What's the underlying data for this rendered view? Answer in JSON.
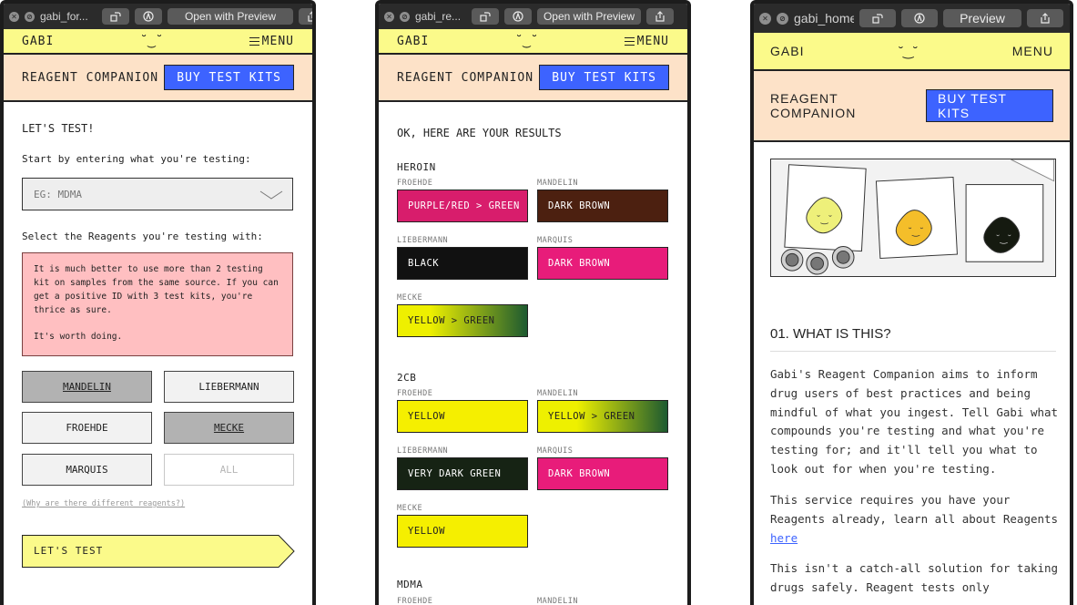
{
  "colors": {
    "yellow": "#fbfa8a",
    "peach": "#fde2c8",
    "blue": "#3d63ff",
    "pink": "#ffbfc1"
  },
  "windows": [
    {
      "title": "gabi_for...",
      "open_label": "Open with Preview"
    },
    {
      "title": "gabi_re...",
      "open_label": "Open with Preview"
    },
    {
      "title": "gabi_home",
      "open_label": "Preview"
    }
  ],
  "header": {
    "logo": "GABI",
    "smiley": "˘‿˘",
    "menu": "MENU",
    "menu_alt": "MENU"
  },
  "subheader": {
    "title": "REAGENT COMPANION",
    "buy": "BUY TEST KITS"
  },
  "form": {
    "heading": "LET'S TEST!",
    "prompt": "Start by entering what you're testing:",
    "select_placeholder": "EG: MDMA",
    "reagents_prompt": "Select the Reagents you're testing with:",
    "warning": [
      "It is much better to use more than 2 testing kit on samples from the same source. If you can get a positive ID with 3 test kits, you're thrice as sure.",
      "It's worth doing."
    ],
    "reagents": [
      {
        "label": "MANDELIN",
        "state": "selected"
      },
      {
        "label": "LIEBERMANN",
        "state": "default"
      },
      {
        "label": "FROEHDE",
        "state": "default"
      },
      {
        "label": "MECKE",
        "state": "selected"
      },
      {
        "label": "MARQUIS",
        "state": "default"
      },
      {
        "label": "ALL",
        "state": "disabled"
      }
    ],
    "why_link": "(Why are there different reagents?)",
    "submit": "LET'S TEST"
  },
  "results": {
    "heading": "OK, HERE ARE YOUR RESULTS",
    "substances": [
      {
        "name": "HEROIN",
        "results": [
          {
            "reagent": "FROEHDE",
            "result": "PURPLE/RED > GREEN",
            "bg": "#d81d6c",
            "fg": "#ffffff"
          },
          {
            "reagent": "MANDELIN",
            "result": "DARK BROWN",
            "bg": "#4c2010",
            "fg": "#ffffff"
          },
          {
            "reagent": "LIEBERMANN",
            "result": "BLACK",
            "bg": "#111111",
            "fg": "#ffffff"
          },
          {
            "reagent": "MARQUIS",
            "result": "DARK BROWN",
            "bg": "#e81c7a",
            "fg": "#ffffff"
          },
          {
            "reagent": "MECKE",
            "result": "YELLOW > GREEN",
            "bg": "linear-gradient(90deg,#eef000 25%,#1d5a30 100%)",
            "fg": "#222222"
          }
        ]
      },
      {
        "name": "2CB",
        "results": [
          {
            "reagent": "FROEHDE",
            "result": "YELLOW",
            "bg": "#f5ef00",
            "fg": "#222222"
          },
          {
            "reagent": "MANDELIN",
            "result": "YELLOW > GREEN",
            "bg": "linear-gradient(90deg,#eef000 30%,#1d5a30 100%)",
            "fg": "#222222"
          },
          {
            "reagent": "LIEBERMANN",
            "result": "VERY DARK GREEN",
            "bg": "#162314",
            "fg": "#ffffff"
          },
          {
            "reagent": "MARQUIS",
            "result": "DARK BROWN",
            "bg": "#e81c7a",
            "fg": "#ffffff"
          },
          {
            "reagent": "MECKE",
            "result": "YELLOW",
            "bg": "#f5ef00",
            "fg": "#222222"
          }
        ]
      }
    ],
    "next_substance": "MDMA",
    "next_labels": [
      "FROEHDE",
      "MANDELIN"
    ]
  },
  "home": {
    "section_title": "01. WHAT IS THIS?",
    "paragraphs": [
      "Gabi's Reagent Companion aims to inform drug users of best practices and being mindful of what you ingest. Tell Gabi what compounds you're testing and what you're testing for; and it'll tell you what to look out for when you're testing.",
      "This service requires you have your Reagents already, learn all about Reagents ",
      "This isn't a catch-all solution for taking drugs safely. Reagent tests only"
    ],
    "here_link": "here"
  }
}
